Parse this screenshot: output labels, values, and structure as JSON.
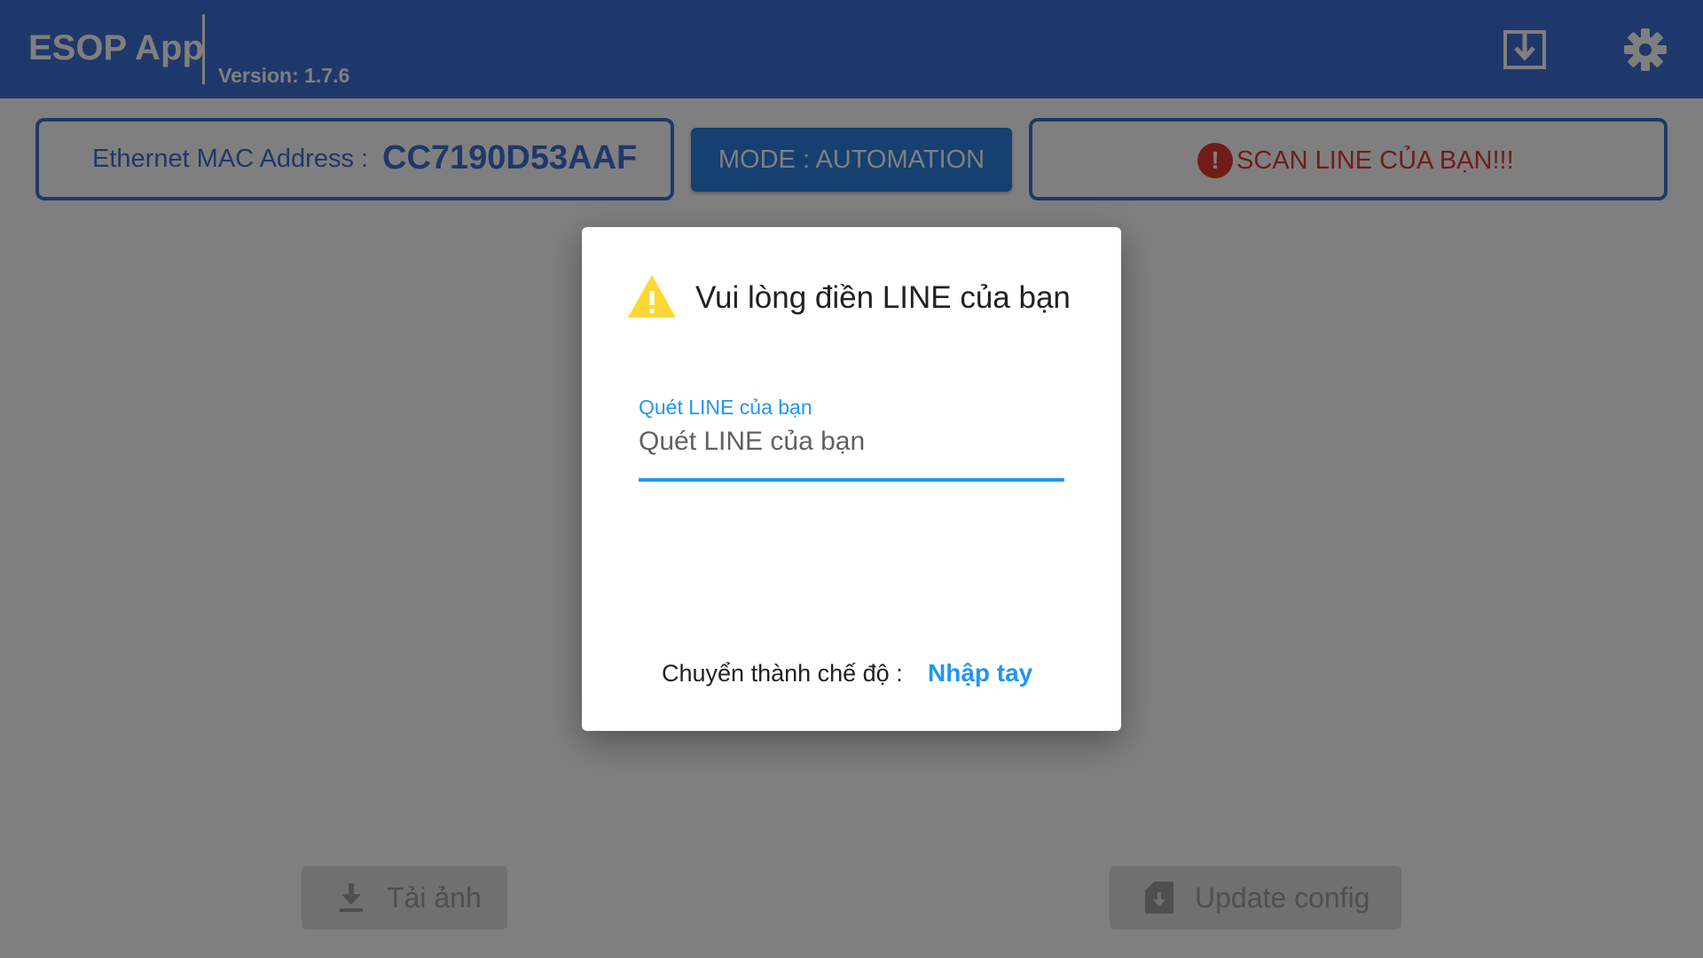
{
  "header": {
    "title": "ESOP App",
    "version": "Version: 1.7.6",
    "download_icon": "download-box-icon",
    "settings_icon": "gear-icon",
    "bg_color": "#3f70d6"
  },
  "mac_card": {
    "label": "Ethernet MAC Address :",
    "value": "CC7190D53AAF"
  },
  "mode_button": {
    "label": "MODE : AUTOMATION"
  },
  "scan_card": {
    "icon": "alert-circle-icon",
    "text": "SCAN LINE CỦA BẠN!!!",
    "color": "#e53935"
  },
  "bottom": {
    "tai_anh_label": "Tải ảnh",
    "update_config_label": "Update config"
  },
  "dialog": {
    "icon": "warning-triangle-icon",
    "title": "Vui lòng điền LINE của bạn",
    "field_label": "Quét LINE của bạn",
    "field_placeholder": "Quét LINE của bạn",
    "switch_label": "Chuyển thành chế độ :",
    "switch_link": "Nhập tay",
    "accent_color": "#2196f3"
  }
}
